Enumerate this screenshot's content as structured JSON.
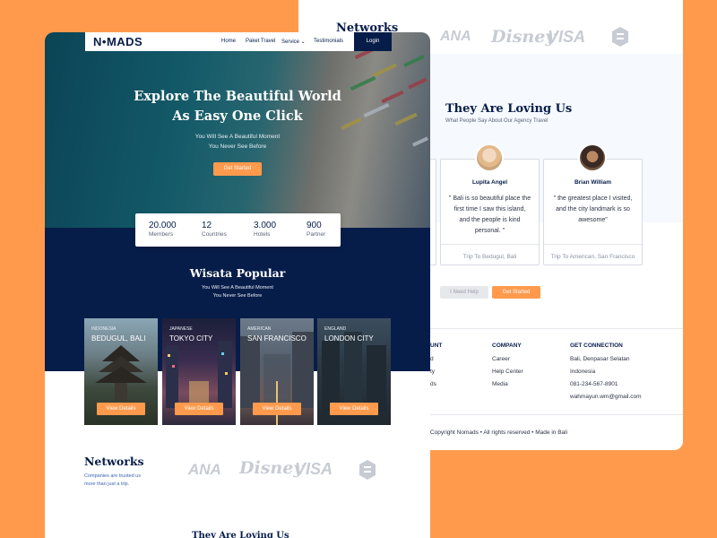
{
  "back": {
    "networks_title": "Networks",
    "partners": [
      "ANA",
      "Disney",
      "VISA"
    ],
    "loving_title": "They Are Loving Us",
    "loving_sub": "What People Say About Our Agency Travel",
    "testimonials": [
      {
        "name": "Lupita Angel",
        "quote": "\" Bali is so beautiful place the first time I saw this island, and the people is kind personal. \"",
        "trip": "Trip To Bedugul, Bali"
      },
      {
        "name": "Brian William",
        "quote": "\" the greatest place I visited, and the city landmark is so awesome\"",
        "trip": "Trip To American, San Francisco"
      }
    ],
    "need_help_label": "I Need Help",
    "get_started_label": "Get Started",
    "footer": {
      "account_title": "UNT",
      "company_title": "COMPANY",
      "company_links": [
        "Career",
        "Help Center",
        "Media"
      ],
      "connection_title": "GET CONNECTION",
      "connection_lines": [
        "Bali, Denpasar Selatan",
        "Indonesia",
        "081-234-567-8901",
        "wahmayun.wm@gmail.com"
      ],
      "partial_links": [
        "d",
        "ty",
        "ds"
      ]
    },
    "copyright": "Copyright Nomads • All rights reserved • Made in Bali"
  },
  "front": {
    "brand": "N•MADS",
    "nav": [
      "Home",
      "Paket Travel",
      "Service ⌄",
      "Testimonials"
    ],
    "login_label": "Login",
    "hero_title_1": "Explore The Beautiful World",
    "hero_title_2": "As Easy One Click",
    "hero_sub_1": "You Will See A Beautiful Moment",
    "hero_sub_2": "You Never See Before",
    "hero_button": "Get Started",
    "stats": [
      {
        "num": "20.000",
        "label": "Members"
      },
      {
        "num": "12",
        "label": "Countries"
      },
      {
        "num": "3.000",
        "label": "Hotels"
      },
      {
        "num": "900",
        "label": "Partner"
      }
    ],
    "popular_title": "Wisata Popular",
    "popular_sub_1": "You Will See A Beautiful Moment",
    "popular_sub_2": "You Never See Before",
    "destinations": [
      {
        "country": "INDONESIA",
        "city": "BEDUGUL, BALI",
        "button": "View Details"
      },
      {
        "country": "JAPANESE",
        "city": "TOKYO CITY",
        "button": "View Details"
      },
      {
        "country": "AMERICAN",
        "city": "SAN FRANCISCO",
        "button": "View Details"
      },
      {
        "country": "ENGLAND",
        "city": "LONDON CITY",
        "button": "View Details"
      }
    ],
    "networks_title": "Networks",
    "networks_sub_1": "Companies are trusted us",
    "networks_sub_2": "more than just a trip.",
    "partners": [
      "ANA",
      "Disney",
      "VISA"
    ],
    "bottom_title": "They Are Loving Us"
  },
  "colors": {
    "accent": "#FF9A4D",
    "navy": "#071D49",
    "page_bg": "#FF9A4D"
  }
}
